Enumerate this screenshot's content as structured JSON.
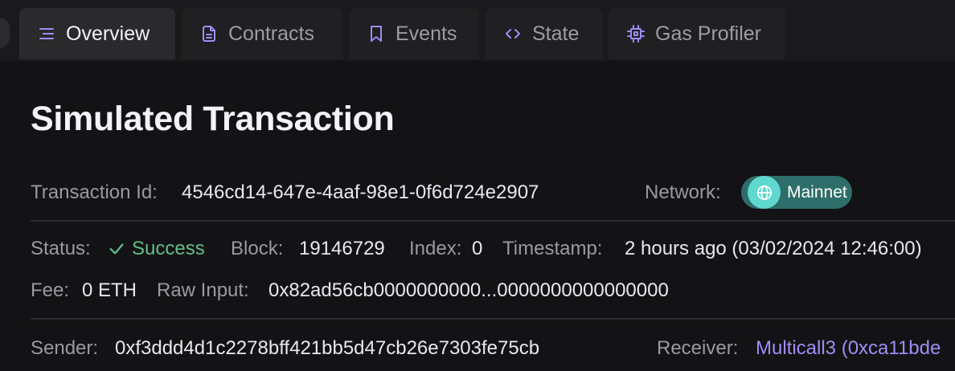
{
  "tabs": [
    {
      "label": "Overview",
      "icon": "list-icon",
      "active": true
    },
    {
      "label": "Contracts",
      "icon": "document-icon"
    },
    {
      "label": "Events",
      "icon": "bookmark-icon"
    },
    {
      "label": "State",
      "icon": "code-icon"
    },
    {
      "label": "Gas Profiler",
      "icon": "cpu-icon"
    }
  ],
  "page": {
    "title": "Simulated Transaction"
  },
  "tx": {
    "id_label": "Transaction Id:",
    "id": "4546cd14-647e-4aaf-98e1-0f6d724e2907",
    "network_label": "Network:",
    "network": "Mainnet",
    "status_label": "Status:",
    "status": "Success",
    "block_label": "Block:",
    "block": "19146729",
    "index_label": "Index:",
    "index": "0",
    "timestamp_label": "Timestamp:",
    "timestamp": "2 hours ago (03/02/2024 12:46:00)",
    "fee_label": "Fee:",
    "fee": "0 ETH",
    "raw_input_label": "Raw Input:",
    "raw_input": "0x82ad56cb0000000000...0000000000000000",
    "sender_label": "Sender:",
    "sender": "0xf3ddd4d1c2278bff421bb5d47cb26e7303fe75cb",
    "receiver_label": "Receiver:",
    "receiver": "Multicall3 (0xca11bde"
  },
  "colors": {
    "accent": "#9e8cf5",
    "success": "#5fbf8a",
    "network_badge": "#2e6e6a",
    "link": "#a28cf8"
  }
}
